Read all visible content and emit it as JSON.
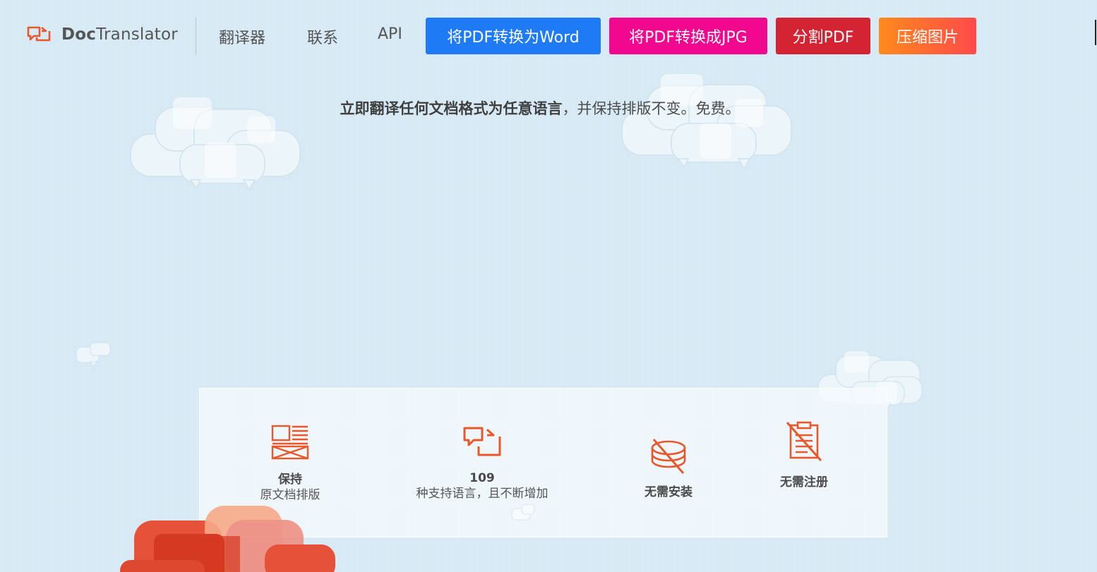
{
  "header": {
    "logo_bold": "Doc",
    "logo_light": "Translator",
    "nav": [
      "翻译器",
      "联系",
      "API"
    ]
  },
  "buttons": [
    {
      "label": "将PDF转换为Word",
      "color": "#1e7bf5"
    },
    {
      "label": "将PDF转换成JPG",
      "color": "#f2078f"
    },
    {
      "label": "分割PDF",
      "color": "#d42332"
    },
    {
      "label": "压缩图片",
      "color": "#ff6a2b"
    }
  ],
  "tagline": {
    "bold": "立即翻译任何文档格式为任意语言",
    "rest": "，并保持排版不变。免费。"
  },
  "features": [
    {
      "icon": "layout-icon",
      "title": "保持",
      "sub": "原文档排版"
    },
    {
      "icon": "translate-icon",
      "title": "109",
      "sub": "种支持语言，且不断增加"
    },
    {
      "icon": "no-install-icon",
      "title": "无需安装",
      "sub": ""
    },
    {
      "icon": "no-register-icon",
      "title": "无需注册",
      "sub": ""
    }
  ],
  "colors": {
    "accent": "#e8582a",
    "background": "#d6e9f4"
  }
}
